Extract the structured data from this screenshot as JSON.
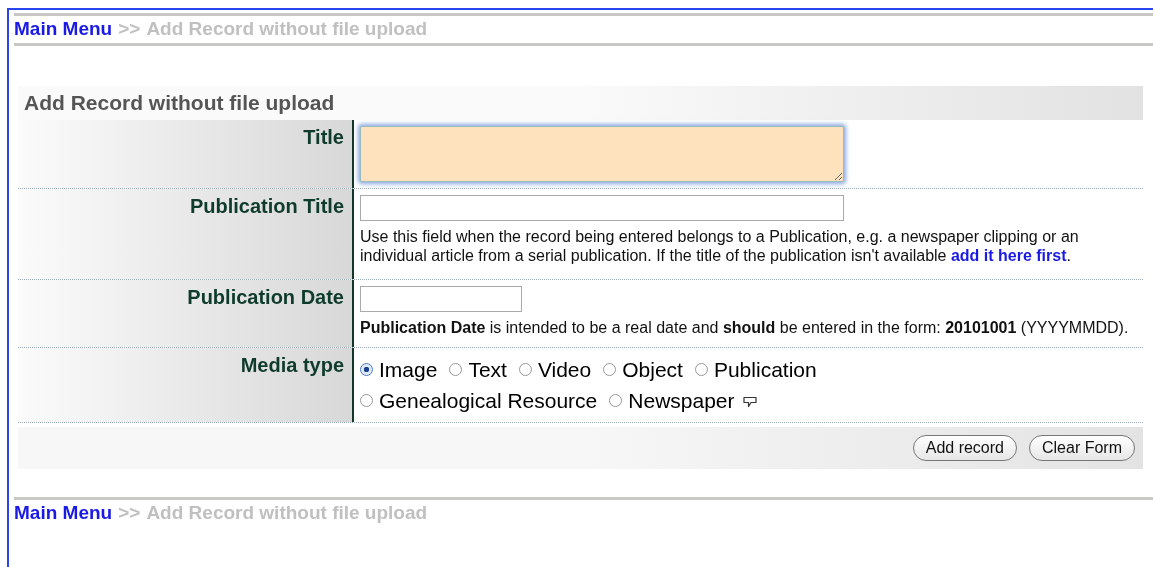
{
  "breadcrumb_top": {
    "link": "Main Menu",
    "separator": ">>",
    "current": "Add Record without file upload"
  },
  "form": {
    "heading": "Add Record without file upload",
    "fields": [
      {
        "kind": "textarea",
        "label": "Title",
        "required": true
      },
      {
        "kind": "text",
        "label": "Publication Title",
        "required": false,
        "help": {
          "text": "Use this field when the record being entered belongs to a Publication, e.g. a newspaper clipping or an individual article from a serial publication. If the title of the publication isn't available ",
          "link": "add it here first",
          "after": "."
        }
      },
      {
        "kind": "short",
        "label": "Publication Date",
        "required": false,
        "help": {
          "text": "**Publication Date** is intended to be a real date and **should** be entered in the form: **20101001** (YYYYMMDD)."
        }
      },
      {
        "kind": "radio",
        "label": "Media type",
        "options": [
          {
            "label": "Image",
            "selected": true
          },
          {
            "label": "Text",
            "selected": false
          },
          {
            "label": "Video",
            "selected": false
          },
          {
            "label": "Object",
            "selected": false
          },
          {
            "label": "Publication",
            "selected": false
          },
          {
            "label": "Genealogical Resource",
            "selected": false
          },
          {
            "label": "Newspaper",
            "selected": false
          }
        ]
      }
    ],
    "buttons": [
      "Add record",
      "Clear Form"
    ]
  },
  "breadcrumb_bottom": {
    "link": "Main Menu",
    "separator": ">>",
    "current": "Add Record without file upload"
  }
}
